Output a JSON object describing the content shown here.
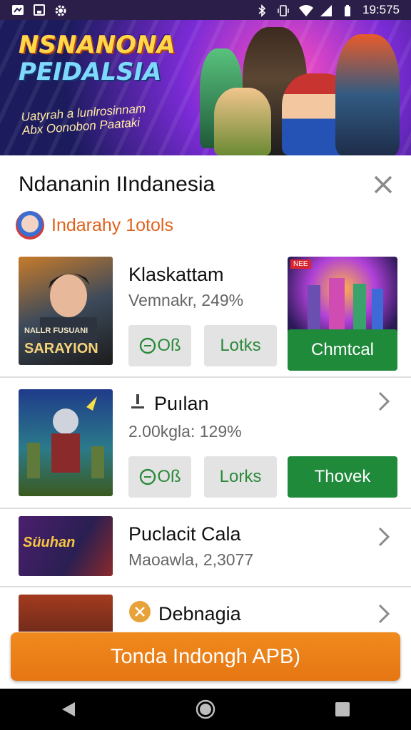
{
  "status_bar": {
    "time": "19:575",
    "left_icons": [
      "notification-icon",
      "photo-icon",
      "settings-icon"
    ],
    "right_icons": [
      "bluetooth-icon",
      "vibrate-icon",
      "wifi-icon",
      "signal-icon",
      "battery-icon"
    ]
  },
  "banner": {
    "title_line1": "NSNANONA",
    "title_line2": "PEIDALSIA",
    "subtitle_line1": "Uatyrah a lunlrosinnam",
    "subtitle_line2": "Abx Oonobon Paataki"
  },
  "sheet": {
    "title": "Ndananin IIndanesia",
    "developer": "Indarahy 1otols",
    "close_icon": "close-icon"
  },
  "cards": [
    {
      "title": "Klaskattam",
      "subtitle": "Vemnakr, 249%",
      "thumb_text_small": "NALLR FUSUANI",
      "thumb_text_big": "SARAYION",
      "button1": "Oß",
      "button2": "Lotks",
      "primary_button": "Chmtcal",
      "promo_tag": "NEE"
    },
    {
      "title": "Puılan",
      "subtitle": "2.00kgla: 129%",
      "button1": "Oß",
      "button2": "Lorks",
      "primary_button": "Thovek"
    },
    {
      "title": "Puclacit Cala",
      "subtitle": "Maoawla, 2,3077",
      "thumb_text_big": "Süuhan"
    },
    {
      "title": "Debnagia"
    }
  ],
  "cta": {
    "label": "Tonda Indongh APB)"
  },
  "colors": {
    "accent_orange": "#e67612",
    "green": "#1f8a3a",
    "dev_orange": "#e0621d"
  }
}
